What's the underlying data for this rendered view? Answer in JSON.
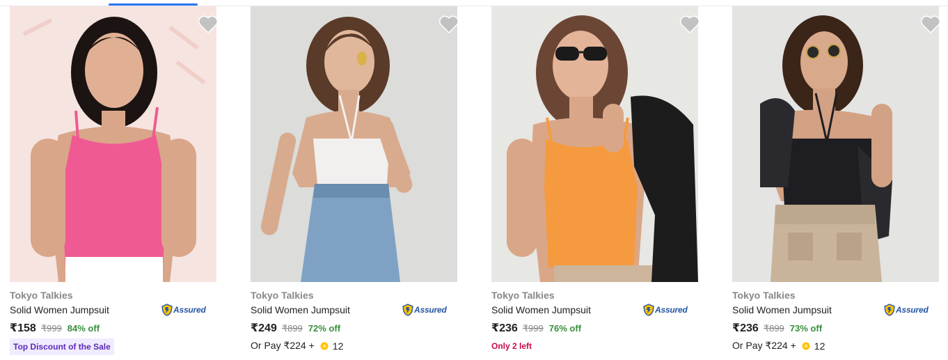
{
  "products": [
    {
      "brand": "Tokyo Talkies",
      "title": "Solid Women Jumpsuit",
      "assured_label": "Assured",
      "price": "₹158",
      "mrp": "₹999",
      "discount": "84% off",
      "badge": "Top Discount of the Sale",
      "top_color": "pink",
      "image_alt": "woman in pink ribbed camisole"
    },
    {
      "brand": "Tokyo Talkies",
      "title": "Solid Women Jumpsuit",
      "assured_label": "Assured",
      "price": "₹249",
      "mrp": "₹899",
      "discount": "72% off",
      "pay_prefix": "Or Pay ₹224 +",
      "pay_coins": "12",
      "top_color": "white",
      "image_alt": "woman in white halter top and denim skirt"
    },
    {
      "brand": "Tokyo Talkies",
      "title": "Solid Women Jumpsuit",
      "assured_label": "Assured",
      "price": "₹236",
      "mrp": "₹999",
      "discount": "76% off",
      "scarcity": "Only 2 left",
      "top_color": "orange",
      "image_alt": "woman in orange ribbed camisole with sunglasses"
    },
    {
      "brand": "Tokyo Talkies",
      "title": "Solid Women Jumpsuit",
      "assured_label": "Assured",
      "price": "₹236",
      "mrp": "₹899",
      "discount": "73% off",
      "pay_prefix": "Or Pay ₹224 +",
      "pay_coins": "12",
      "top_color": "black",
      "image_alt": "woman in black halter top and beige cargo skirt"
    }
  ],
  "icons": {
    "wishlist": "heart-icon",
    "assured": "assured-shield-icon",
    "coin": "supercoin-icon"
  },
  "colors": {
    "accent": "#2874f0",
    "discount_green": "#388e3c",
    "scarcity_red": "#c80a4d",
    "badge_bg": "#f1ebff",
    "badge_text": "#5a2ab8",
    "assured_blue": "#2455a4",
    "coin_gold": "#ffc200"
  }
}
